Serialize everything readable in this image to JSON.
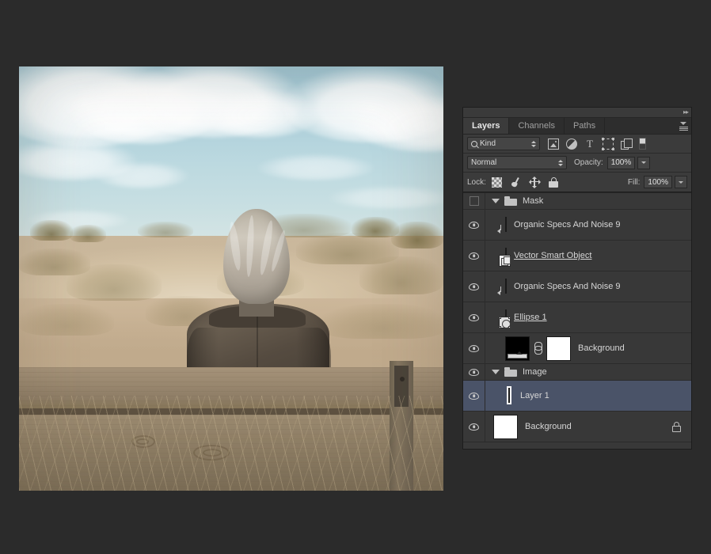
{
  "panel": {
    "tabs": [
      {
        "label": "Layers",
        "active": true
      },
      {
        "label": "Channels",
        "active": false
      },
      {
        "label": "Paths",
        "active": false
      }
    ],
    "collapse_glyph": "▸▸",
    "filter": {
      "kind_label": "Kind",
      "icons": [
        "image-filter-icon",
        "adjustment-filter-icon",
        "text-filter-icon",
        "shape-filter-icon",
        "smart-object-filter-icon",
        "filter-toggle-icon"
      ]
    },
    "blend": {
      "mode": "Normal",
      "opacity_label": "Opacity:",
      "opacity_value": "100%"
    },
    "lock": {
      "label": "Lock:",
      "icons": [
        "lock-transparent-pixels-icon",
        "lock-image-pixels-icon",
        "lock-position-icon",
        "lock-all-icon"
      ],
      "fill_label": "Fill:",
      "fill_value": "100%"
    },
    "layers": [
      {
        "name": "Mask",
        "type": "group",
        "visible": false,
        "expanded": true,
        "selected": false
      },
      {
        "name": "Organic Specs And Noise 9",
        "type": "layer",
        "visible": true,
        "clipped": true,
        "thumb": "dark-noise",
        "selected": false,
        "underlined": false
      },
      {
        "name": "Vector Smart Object",
        "type": "layer",
        "visible": true,
        "clipped": false,
        "thumb": "checker-vector",
        "badge": "smart-object",
        "selected": false,
        "underlined": true
      },
      {
        "name": "Organic Specs And Noise 9",
        "type": "layer",
        "visible": true,
        "clipped": true,
        "thumb": "light-noise",
        "selected": false,
        "underlined": false
      },
      {
        "name": "Ellipse 1",
        "type": "layer",
        "visible": true,
        "clipped": false,
        "thumb": "checker-ellipse",
        "badge": "shape",
        "selected": false,
        "underlined": true
      },
      {
        "name": "Background",
        "type": "layer",
        "visible": true,
        "clipped": false,
        "thumb": "gradient-black",
        "mask_thumb": "white",
        "linked": true,
        "selected": false,
        "underlined": false
      },
      {
        "name": "Image",
        "type": "group",
        "visible": true,
        "expanded": true,
        "selected": false
      },
      {
        "name": "Layer 1",
        "type": "layer",
        "visible": true,
        "clipped": false,
        "thumb": "photo",
        "selected": true,
        "underlined": false
      },
      {
        "name": "Background",
        "type": "layer",
        "visible": true,
        "clipped": false,
        "thumb": "white",
        "locked": true,
        "selected": false,
        "underlined": false
      }
    ]
  },
  "colors": {
    "app_background": "#2b2b2b",
    "panel_background": "#323232",
    "panel_controls": "#3b3b3b",
    "layer_list_background": "#383838",
    "selected_row": "#4a5368",
    "text": "#d6d6d6",
    "tab_active_text": "#e6e6e6"
  },
  "document": {
    "canvas_alt": "Photograph of a person with grey hair seated on a wooden bench facing away toward a sand dune with dry grass"
  }
}
